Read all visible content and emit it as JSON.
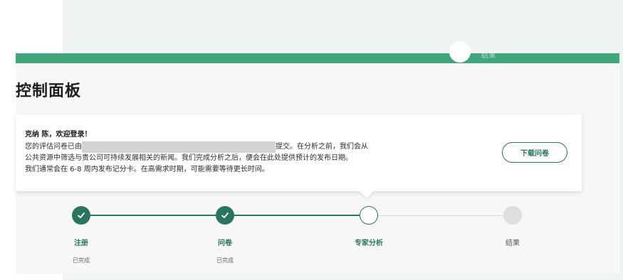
{
  "header": {
    "step_hint": "结果"
  },
  "page": {
    "title": "控制面板"
  },
  "welcome": {
    "greeting": "克纳 陈，欢迎登录！",
    "line1_prefix": "您的评估问卷已由",
    "line1_suffix": "提交。在分析之前，我们会从",
    "line2": "公共资源中筛选与贵公司可持续发展相关的新闻。我们完成分析之后，便会在此处提供预计的发布日期。",
    "line3": "我们通常会在 6-8 周内发布记分卡。在高需求时期，可能需要等待更长时间。",
    "download_label": "下载问卷"
  },
  "progress": {
    "steps": [
      {
        "label": "注册",
        "status": "已完成",
        "state": "done"
      },
      {
        "label": "问卷",
        "status": "已完成",
        "state": "done"
      },
      {
        "label": "专家分析",
        "status": "",
        "state": "current"
      },
      {
        "label": "结果",
        "status": "",
        "state": "pending"
      }
    ]
  },
  "colors": {
    "brand_green": "#3fa57b",
    "step_green": "#2a7560",
    "pending_gray": "#dedede",
    "panel_bg": "#f7f7f7",
    "page_bg": "#edf4f2"
  },
  "icons": {
    "done": "checkmark-icon"
  }
}
